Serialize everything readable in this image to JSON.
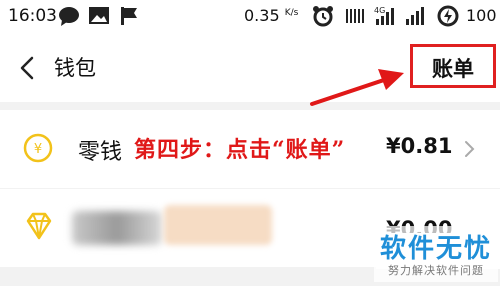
{
  "status_bar": {
    "time": "16:03",
    "speed_value": "0.35",
    "speed_unit": "K/s",
    "network": "4G",
    "battery": "100"
  },
  "nav": {
    "title": "钱包",
    "bill_label": "账单"
  },
  "rows": [
    {
      "label": "零钱",
      "amount": "¥0.81",
      "icon": "yuan-coin-icon"
    },
    {
      "label": "",
      "amount": "¥0.00",
      "icon": "diamond-icon"
    }
  ],
  "annotation": "第四步：点击“账单”",
  "watermark": {
    "title": "软件无忧",
    "subtitle": "努力解决软件问题"
  },
  "colors": {
    "accent_gold": "#f2c21a",
    "annotation_red": "#e01818",
    "watermark_blue": "#1f8fd8"
  }
}
